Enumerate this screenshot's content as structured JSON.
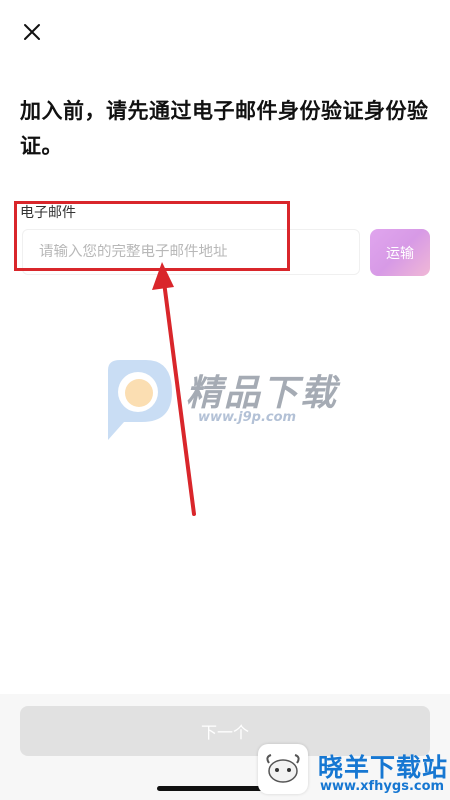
{
  "header": {
    "close_icon": "close-icon"
  },
  "main": {
    "title": "加入前，请先通过电子邮件身份验证身份验证。",
    "email": {
      "label": "电子邮件",
      "placeholder": "请输入您的完整电子邮件地址",
      "value": "",
      "send_button_label": "运输"
    }
  },
  "footer": {
    "next_button_label": "下一个"
  },
  "watermarks": {
    "center": {
      "text": "精品下载",
      "url": "www.j9p.com",
      "icon": "speech-bubble-logo-icon"
    },
    "corner": {
      "title": "晓羊下载站",
      "url": "www.xfhygs.com",
      "icon": "sheep-logo-icon"
    }
  },
  "annotation": {
    "color": "#d9262b"
  },
  "colors": {
    "accent": "#d79ae6",
    "disabled_button": "#e1e1e1"
  }
}
